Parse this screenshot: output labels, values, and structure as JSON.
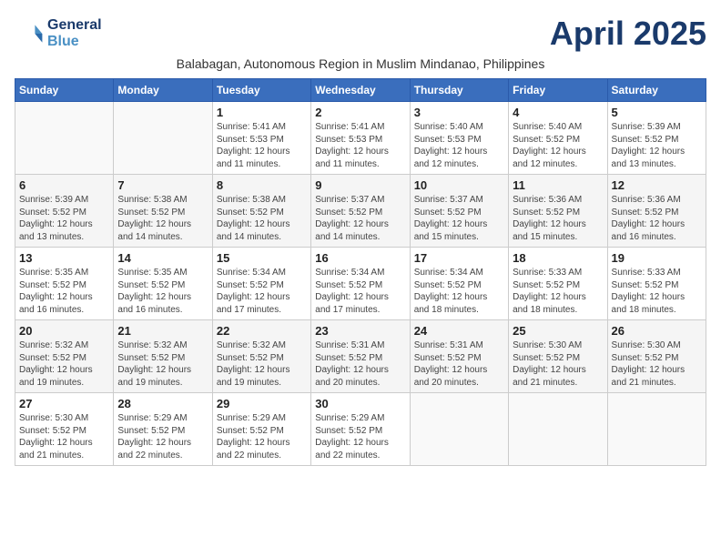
{
  "header": {
    "logo_line1": "General",
    "logo_line2": "Blue",
    "month": "April 2025",
    "subtitle": "Balabagan, Autonomous Region in Muslim Mindanao, Philippines"
  },
  "days_of_week": [
    "Sunday",
    "Monday",
    "Tuesday",
    "Wednesday",
    "Thursday",
    "Friday",
    "Saturday"
  ],
  "weeks": [
    [
      {
        "day": "",
        "info": ""
      },
      {
        "day": "",
        "info": ""
      },
      {
        "day": "1",
        "info": "Sunrise: 5:41 AM\nSunset: 5:53 PM\nDaylight: 12 hours\nand 11 minutes."
      },
      {
        "day": "2",
        "info": "Sunrise: 5:41 AM\nSunset: 5:53 PM\nDaylight: 12 hours\nand 11 minutes."
      },
      {
        "day": "3",
        "info": "Sunrise: 5:40 AM\nSunset: 5:53 PM\nDaylight: 12 hours\nand 12 minutes."
      },
      {
        "day": "4",
        "info": "Sunrise: 5:40 AM\nSunset: 5:52 PM\nDaylight: 12 hours\nand 12 minutes."
      },
      {
        "day": "5",
        "info": "Sunrise: 5:39 AM\nSunset: 5:52 PM\nDaylight: 12 hours\nand 13 minutes."
      }
    ],
    [
      {
        "day": "6",
        "info": "Sunrise: 5:39 AM\nSunset: 5:52 PM\nDaylight: 12 hours\nand 13 minutes."
      },
      {
        "day": "7",
        "info": "Sunrise: 5:38 AM\nSunset: 5:52 PM\nDaylight: 12 hours\nand 14 minutes."
      },
      {
        "day": "8",
        "info": "Sunrise: 5:38 AM\nSunset: 5:52 PM\nDaylight: 12 hours\nand 14 minutes."
      },
      {
        "day": "9",
        "info": "Sunrise: 5:37 AM\nSunset: 5:52 PM\nDaylight: 12 hours\nand 14 minutes."
      },
      {
        "day": "10",
        "info": "Sunrise: 5:37 AM\nSunset: 5:52 PM\nDaylight: 12 hours\nand 15 minutes."
      },
      {
        "day": "11",
        "info": "Sunrise: 5:36 AM\nSunset: 5:52 PM\nDaylight: 12 hours\nand 15 minutes."
      },
      {
        "day": "12",
        "info": "Sunrise: 5:36 AM\nSunset: 5:52 PM\nDaylight: 12 hours\nand 16 minutes."
      }
    ],
    [
      {
        "day": "13",
        "info": "Sunrise: 5:35 AM\nSunset: 5:52 PM\nDaylight: 12 hours\nand 16 minutes."
      },
      {
        "day": "14",
        "info": "Sunrise: 5:35 AM\nSunset: 5:52 PM\nDaylight: 12 hours\nand 16 minutes."
      },
      {
        "day": "15",
        "info": "Sunrise: 5:34 AM\nSunset: 5:52 PM\nDaylight: 12 hours\nand 17 minutes."
      },
      {
        "day": "16",
        "info": "Sunrise: 5:34 AM\nSunset: 5:52 PM\nDaylight: 12 hours\nand 17 minutes."
      },
      {
        "day": "17",
        "info": "Sunrise: 5:34 AM\nSunset: 5:52 PM\nDaylight: 12 hours\nand 18 minutes."
      },
      {
        "day": "18",
        "info": "Sunrise: 5:33 AM\nSunset: 5:52 PM\nDaylight: 12 hours\nand 18 minutes."
      },
      {
        "day": "19",
        "info": "Sunrise: 5:33 AM\nSunset: 5:52 PM\nDaylight: 12 hours\nand 18 minutes."
      }
    ],
    [
      {
        "day": "20",
        "info": "Sunrise: 5:32 AM\nSunset: 5:52 PM\nDaylight: 12 hours\nand 19 minutes."
      },
      {
        "day": "21",
        "info": "Sunrise: 5:32 AM\nSunset: 5:52 PM\nDaylight: 12 hours\nand 19 minutes."
      },
      {
        "day": "22",
        "info": "Sunrise: 5:32 AM\nSunset: 5:52 PM\nDaylight: 12 hours\nand 19 minutes."
      },
      {
        "day": "23",
        "info": "Sunrise: 5:31 AM\nSunset: 5:52 PM\nDaylight: 12 hours\nand 20 minutes."
      },
      {
        "day": "24",
        "info": "Sunrise: 5:31 AM\nSunset: 5:52 PM\nDaylight: 12 hours\nand 20 minutes."
      },
      {
        "day": "25",
        "info": "Sunrise: 5:30 AM\nSunset: 5:52 PM\nDaylight: 12 hours\nand 21 minutes."
      },
      {
        "day": "26",
        "info": "Sunrise: 5:30 AM\nSunset: 5:52 PM\nDaylight: 12 hours\nand 21 minutes."
      }
    ],
    [
      {
        "day": "27",
        "info": "Sunrise: 5:30 AM\nSunset: 5:52 PM\nDaylight: 12 hours\nand 21 minutes."
      },
      {
        "day": "28",
        "info": "Sunrise: 5:29 AM\nSunset: 5:52 PM\nDaylight: 12 hours\nand 22 minutes."
      },
      {
        "day": "29",
        "info": "Sunrise: 5:29 AM\nSunset: 5:52 PM\nDaylight: 12 hours\nand 22 minutes."
      },
      {
        "day": "30",
        "info": "Sunrise: 5:29 AM\nSunset: 5:52 PM\nDaylight: 12 hours\nand 22 minutes."
      },
      {
        "day": "",
        "info": ""
      },
      {
        "day": "",
        "info": ""
      },
      {
        "day": "",
        "info": ""
      }
    ]
  ]
}
